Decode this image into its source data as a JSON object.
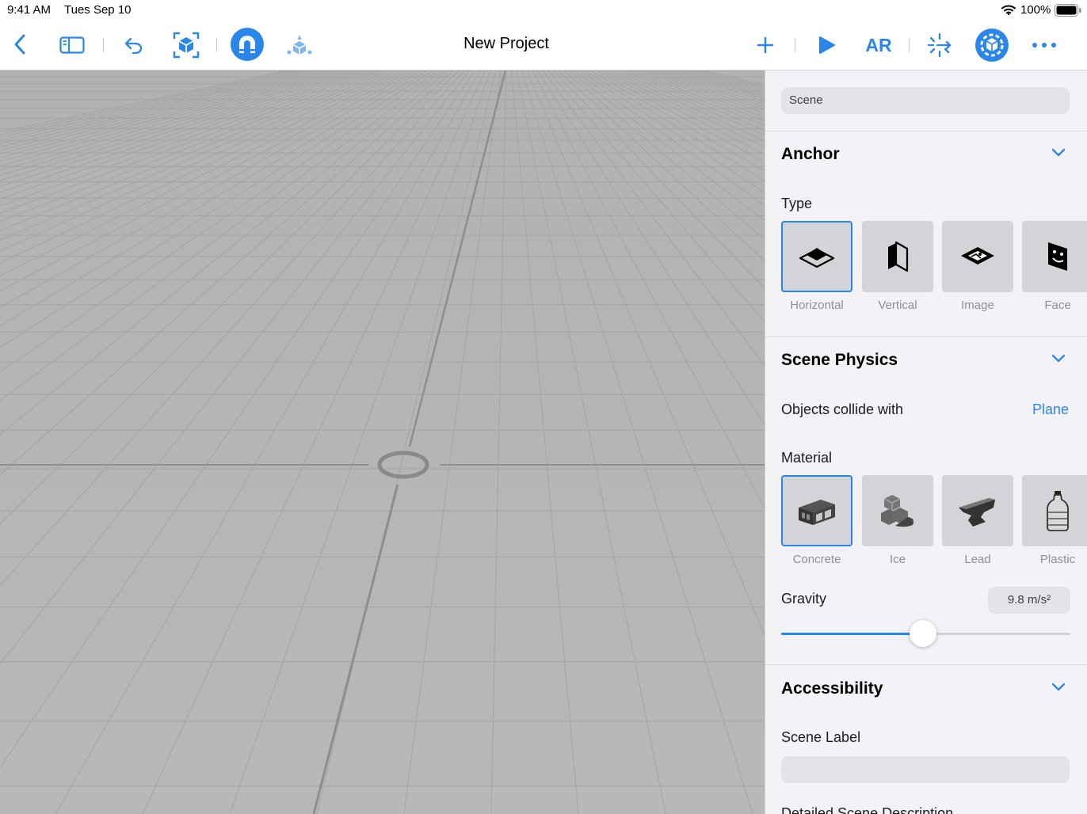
{
  "status": {
    "time": "9:41 AM",
    "date": "Tues Sep 10",
    "battery": "100%"
  },
  "toolbar": {
    "title": "New Project",
    "left_icons": [
      "back-chevron-icon",
      "sidebar-icon",
      "undo-icon",
      "cube-select-icon",
      "snap-magnet-icon",
      "object-library-icon"
    ],
    "right_icons": [
      "add-icon",
      "play-icon",
      "ar-icon",
      "transform-icon",
      "scene-settings-icon",
      "more-icon"
    ],
    "ar_label": "AR"
  },
  "panel": {
    "scene_field": "Scene",
    "anchor": {
      "title": "Anchor",
      "type_label": "Type",
      "types": [
        {
          "label": "Horizontal",
          "selected": true
        },
        {
          "label": "Vertical",
          "selected": false
        },
        {
          "label": "Image",
          "selected": false
        },
        {
          "label": "Face",
          "selected": false
        }
      ]
    },
    "physics": {
      "title": "Scene Physics",
      "collide_label": "Objects collide with",
      "collide_value": "Plane",
      "material_label": "Material",
      "materials": [
        {
          "label": "Concrete",
          "selected": true
        },
        {
          "label": "Ice",
          "selected": false
        },
        {
          "label": "Lead",
          "selected": false
        },
        {
          "label": "Plastic",
          "selected": false
        }
      ],
      "gravity_label": "Gravity",
      "gravity_value": "9.8 m/s²",
      "gravity_fraction": 0.49
    },
    "accessibility": {
      "title": "Accessibility",
      "scene_label": "Scene Label",
      "scene_label_value": "",
      "description_label": "Detailed Scene Description"
    }
  },
  "colors": {
    "accent": "#2a86e8",
    "panel_bg": "#f2f2f7",
    "viewport_bg": "#b4b4b4"
  }
}
